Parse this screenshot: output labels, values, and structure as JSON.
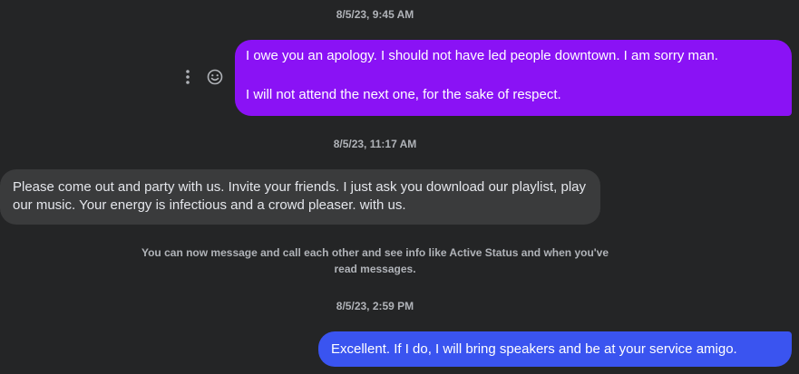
{
  "thread": {
    "messages": [
      {
        "timestamp": "8/5/23, 9:45 AM",
        "direction": "outgoing",
        "lines": [
          "I owe you an apology. I should not have led people downtown. I am sorry man.",
          "I will not attend the next one, for the sake of respect."
        ]
      },
      {
        "timestamp": "8/5/23, 11:17 AM",
        "direction": "incoming",
        "text": "Please come out and party with us. Invite your friends. I just ask you download our playlist, play our music. Your energy is infectious and a crowd pleaser. with us."
      },
      {
        "timestamp": "8/5/23, 2:59 PM",
        "direction": "outgoing",
        "text": "Excellent. If I do, I will bring speakers and be at your service amigo."
      }
    ],
    "system_note": "You can now message and call each other and see info like Active Status and when you've read messages."
  },
  "actions": {
    "more_icon": "more-vertical-icon",
    "react_icon": "smiley-icon"
  },
  "colors": {
    "background": "#242526",
    "outgoing_purple": "#8a12f5",
    "outgoing_blue": "#3a54f0",
    "incoming": "#3a3b3c",
    "muted_text": "#b0b3b8"
  }
}
